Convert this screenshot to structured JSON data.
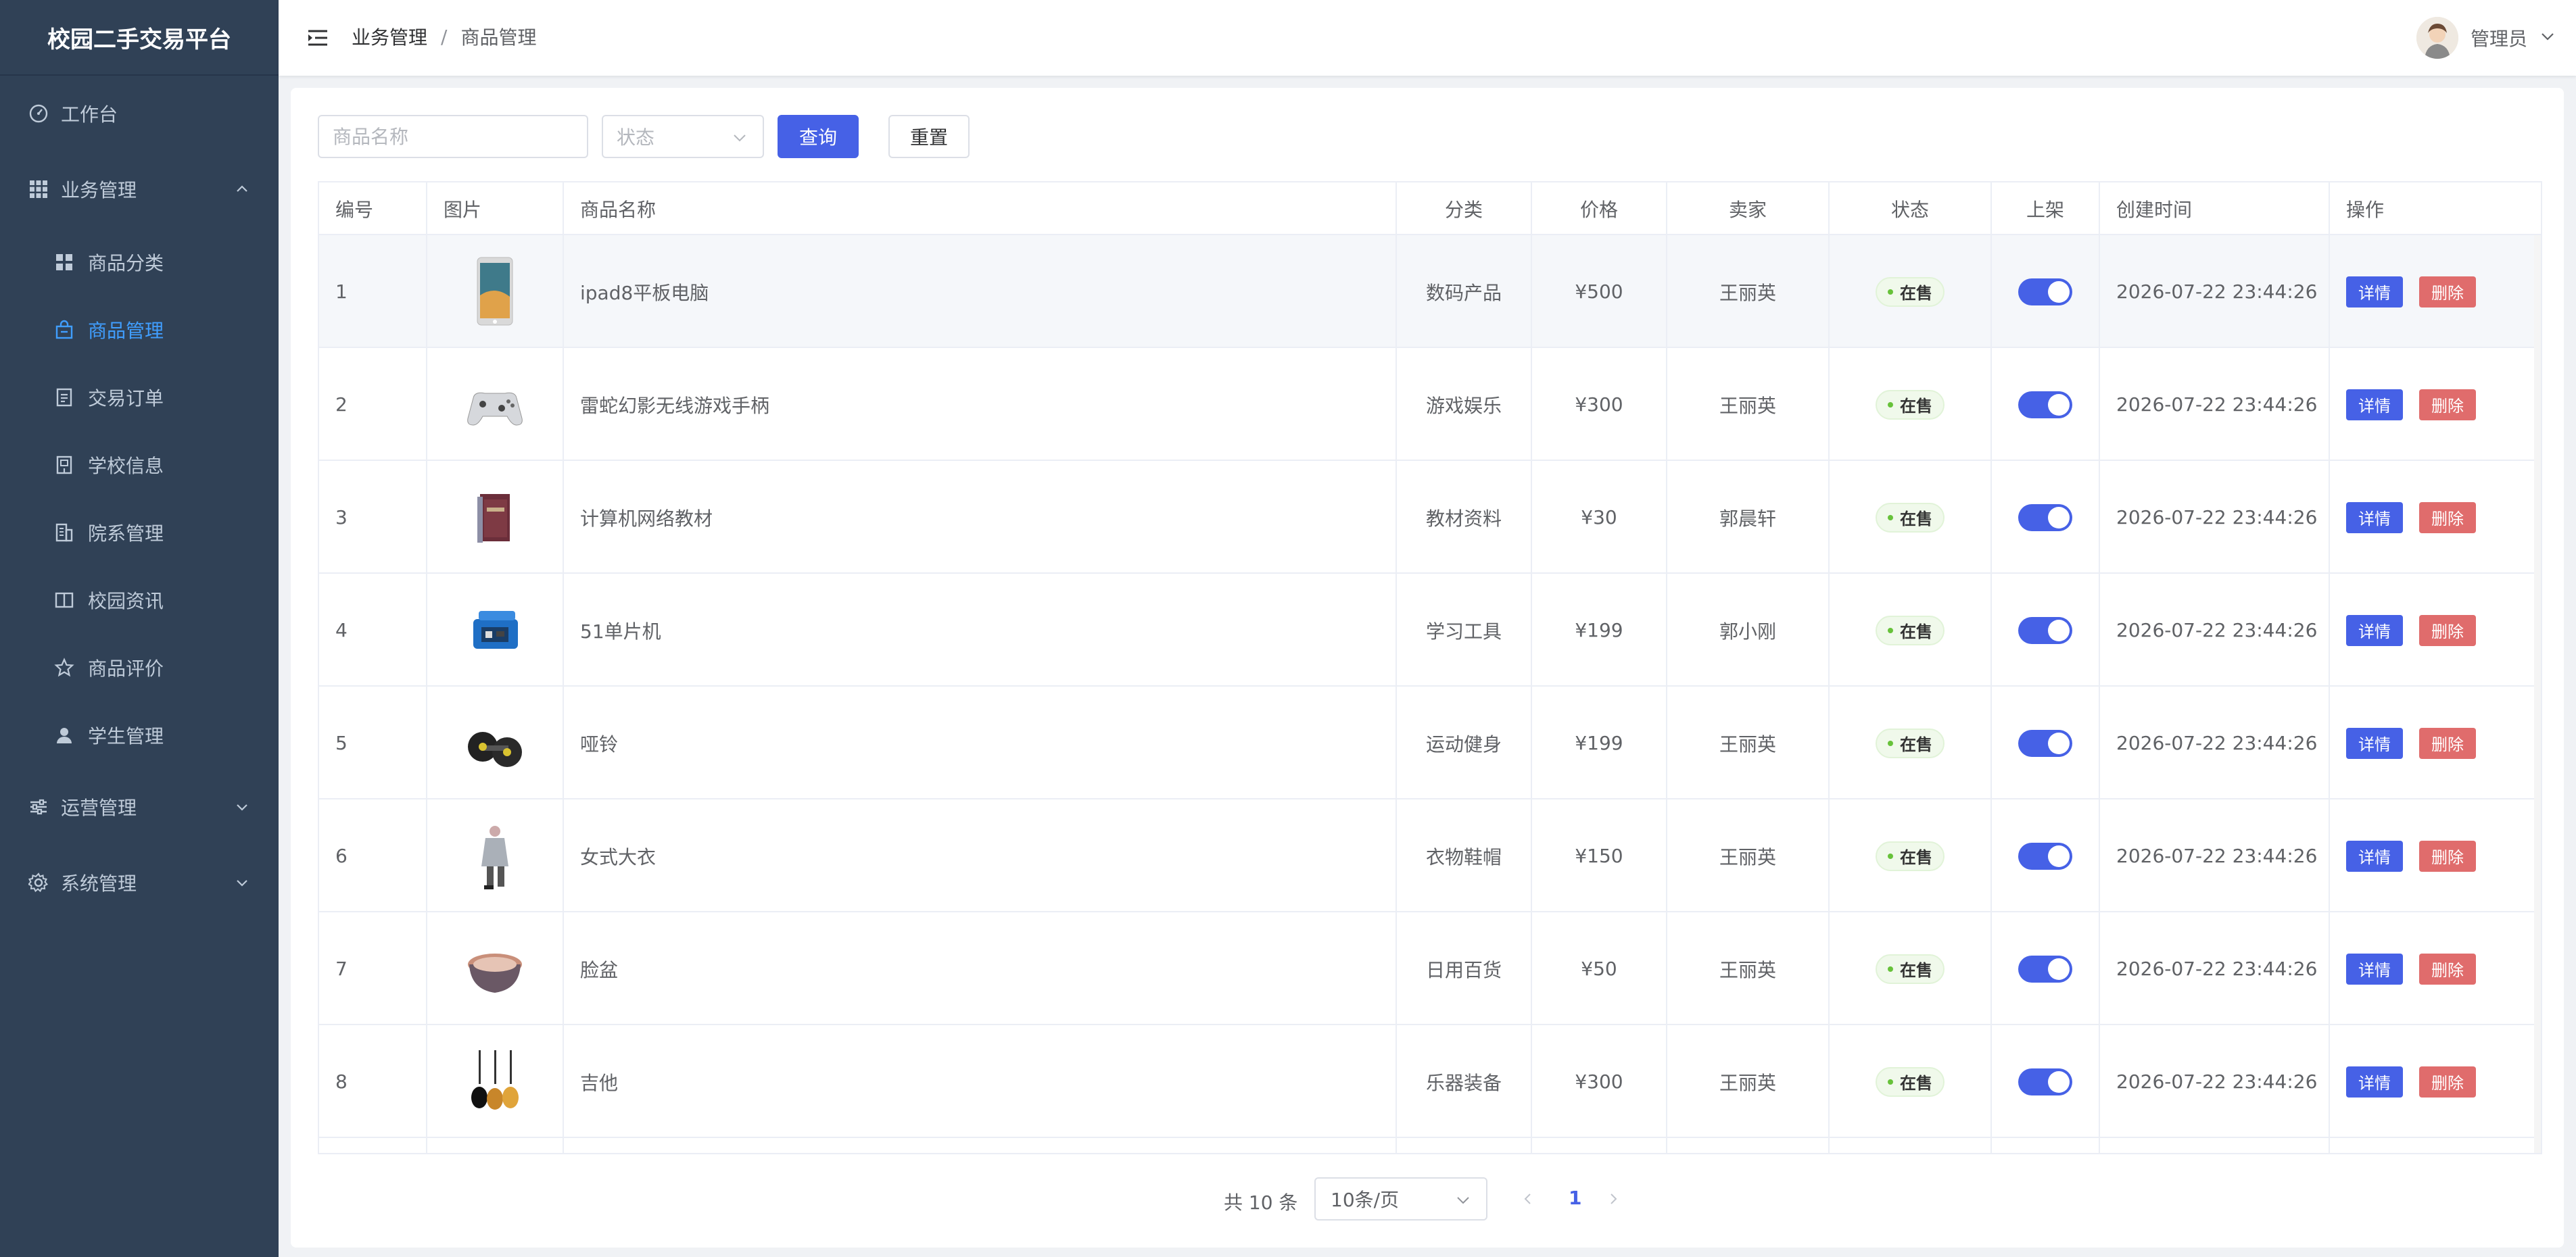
{
  "sidebar": {
    "brand": "校园二手交易平台",
    "items": [
      {
        "label": "工作台",
        "icon": "dashboard-icon"
      },
      {
        "label": "业务管理",
        "icon": "grid-icon"
      },
      {
        "label": "商品分类",
        "icon": "category-icon"
      },
      {
        "label": "商品管理",
        "icon": "shopping-bag-icon"
      },
      {
        "label": "交易订单",
        "icon": "order-icon"
      },
      {
        "label": "学校信息",
        "icon": "school-icon"
      },
      {
        "label": "院系管理",
        "icon": "building-icon"
      },
      {
        "label": "校园资讯",
        "icon": "book-icon"
      },
      {
        "label": "商品评价",
        "icon": "star-icon"
      },
      {
        "label": "学生管理",
        "icon": "user-icon"
      },
      {
        "label": "运营管理",
        "icon": "sliders-icon"
      },
      {
        "label": "系统管理",
        "icon": "gear-icon"
      }
    ]
  },
  "header": {
    "breadcrumb": [
      "业务管理",
      "商品管理"
    ],
    "separator": "/",
    "user": "管理员"
  },
  "search": {
    "name_placeholder": "商品名称",
    "status_placeholder": "状态",
    "query_label": "查询",
    "reset_label": "重置"
  },
  "table": {
    "columns": [
      "编号",
      "图片",
      "商品名称",
      "分类",
      "价格",
      "卖家",
      "状态",
      "上架",
      "创建时间",
      "操作"
    ],
    "rows": [
      {
        "id": "1",
        "image": "tablet",
        "name": "ipad8平板电脑",
        "category": "数码产品",
        "price": "¥500",
        "seller": "王丽英",
        "status": "在售",
        "on_shelf": true,
        "created": "2026-07-22 23:44:26"
      },
      {
        "id": "2",
        "image": "gamepad",
        "name": "雷蛇幻影无线游戏手柄",
        "category": "游戏娱乐",
        "price": "¥300",
        "seller": "王丽英",
        "status": "在售",
        "on_shelf": true,
        "created": "2026-07-22 23:44:26"
      },
      {
        "id": "3",
        "image": "books",
        "name": "计算机网络教材",
        "category": "教材资料",
        "price": "¥30",
        "seller": "郭晨轩",
        "status": "在售",
        "on_shelf": true,
        "created": "2026-07-22 23:44:26"
      },
      {
        "id": "4",
        "image": "board",
        "name": "51单片机",
        "category": "学习工具",
        "price": "¥199",
        "seller": "郭小刚",
        "status": "在售",
        "on_shelf": true,
        "created": "2026-07-22 23:44:26"
      },
      {
        "id": "5",
        "image": "dumbbell",
        "name": "哑铃",
        "category": "运动健身",
        "price": "¥199",
        "seller": "王丽英",
        "status": "在售",
        "on_shelf": true,
        "created": "2026-07-22 23:44:26"
      },
      {
        "id": "6",
        "image": "coat",
        "name": "女式大衣",
        "category": "衣物鞋帽",
        "price": "¥150",
        "seller": "王丽英",
        "status": "在售",
        "on_shelf": true,
        "created": "2026-07-22 23:44:26"
      },
      {
        "id": "7",
        "image": "basin",
        "name": "脸盆",
        "category": "日用百货",
        "price": "¥50",
        "seller": "王丽英",
        "status": "在售",
        "on_shelf": true,
        "created": "2026-07-22 23:44:26"
      },
      {
        "id": "8",
        "image": "guitar",
        "name": "吉他",
        "category": "乐器装备",
        "price": "¥300",
        "seller": "王丽英",
        "status": "在售",
        "on_shelf": true,
        "created": "2026-07-22 23:44:26"
      }
    ],
    "detail_label": "详情",
    "delete_label": "删除"
  },
  "pagination": {
    "total": "共 10 条",
    "page_size": "10条/页",
    "current_page": "1"
  },
  "colors": {
    "sidebar_bg": "#304156",
    "active": "#409eff",
    "primary": "#4661e6",
    "danger": "#e06c6c"
  }
}
